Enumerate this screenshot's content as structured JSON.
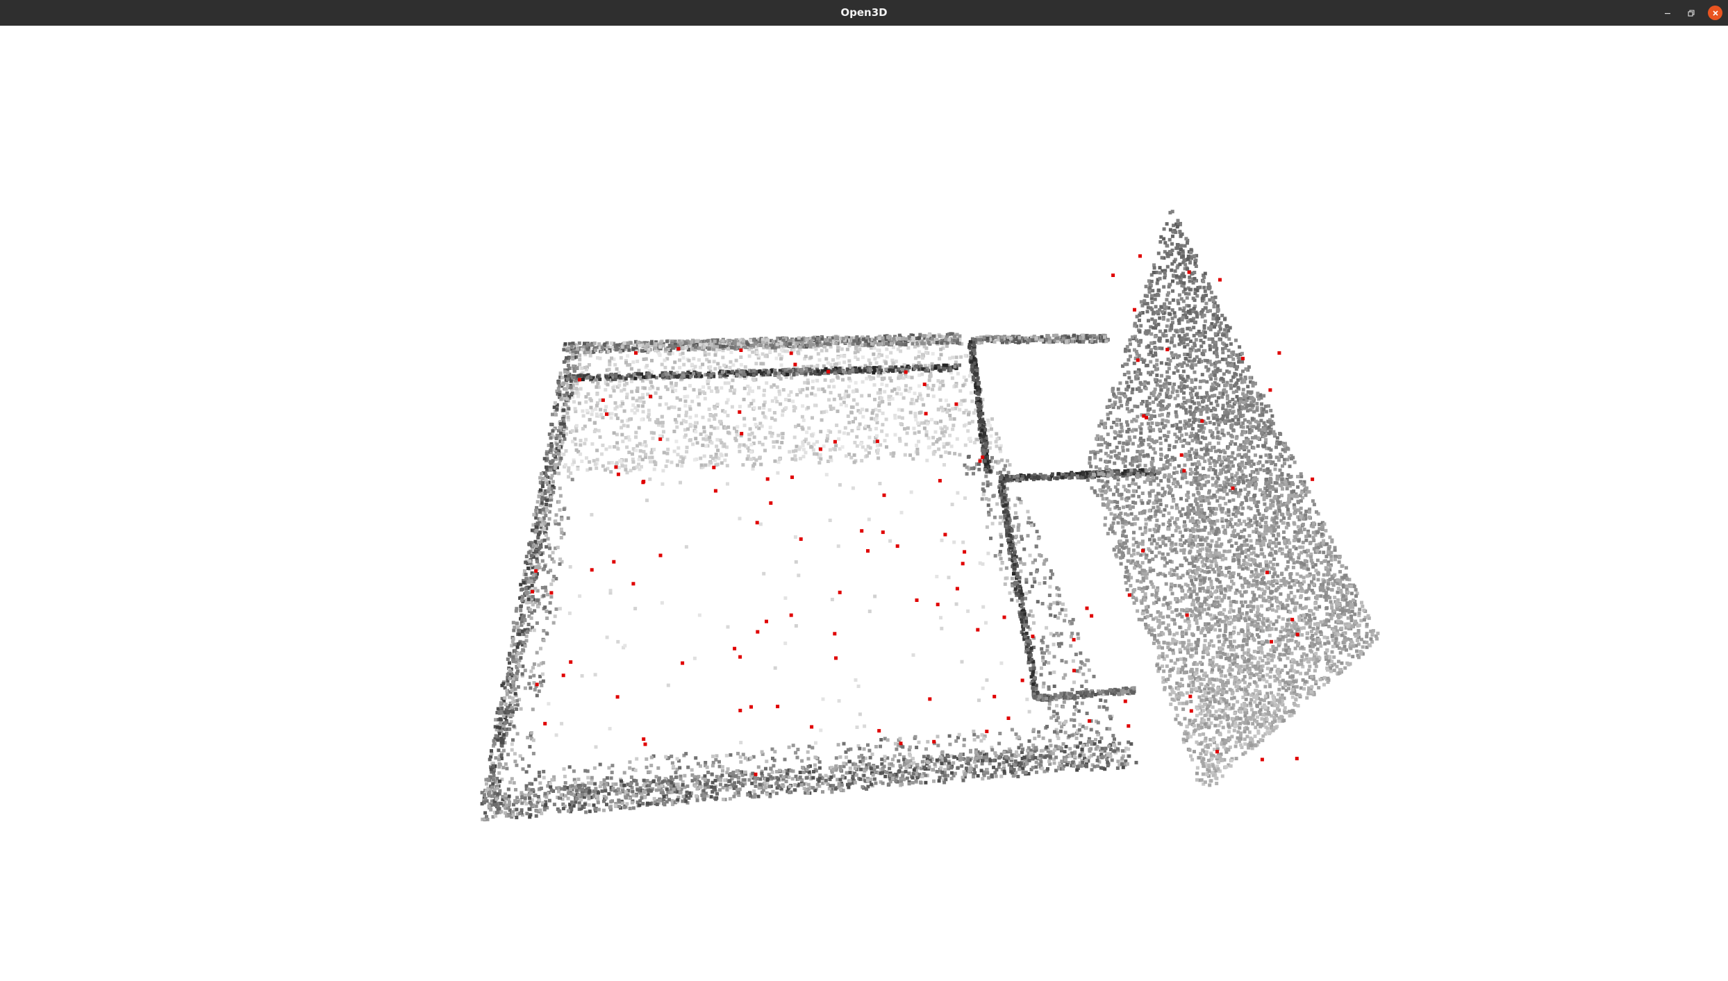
{
  "window": {
    "title": "Open3D",
    "controls": {
      "minimize_icon": "minimize-icon",
      "maximize_icon": "restore-icon",
      "close_icon": "close-icon"
    },
    "colors": {
      "titlebar": "#2f2f2f",
      "title_text": "#f2f2f2",
      "close_button": "#e95420",
      "canvas_background": "#ffffff"
    }
  },
  "scene": {
    "type": "point-cloud",
    "point_colors": [
      "#1a1a1a",
      "#555555",
      "#8a8a8a",
      "#b5b5b5",
      "#dcdcdc",
      "#e00000"
    ]
  }
}
